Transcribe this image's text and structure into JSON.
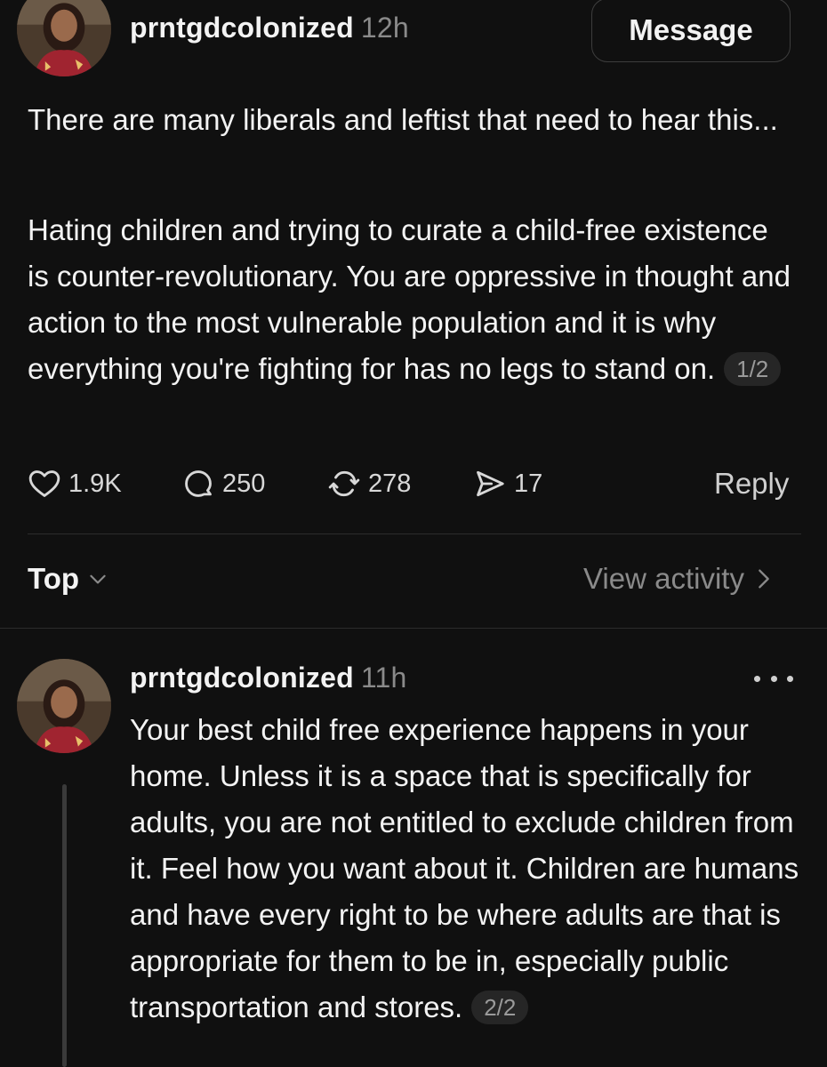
{
  "post": {
    "username": "prntgdcolonized",
    "time": "12h",
    "message_button": "Message",
    "paragraph1": "There are many liberals and leftist that need to hear this...",
    "paragraph2": "Hating children and trying to curate a child-free existence is counter-revolutionary. You are oppressive in thought and action to the most vulnerable population and it is why everything you're fighting for has no legs to stand on.",
    "page_indicator": "1/2",
    "actions": {
      "likes": "1.9K",
      "comments": "250",
      "reposts": "278",
      "shares": "17",
      "reply_label": "Reply"
    },
    "icons": [
      "heart-icon",
      "comment-icon",
      "repost-icon",
      "send-icon"
    ]
  },
  "sort": {
    "label": "Top",
    "view_activity": "View activity"
  },
  "reply": {
    "username": "prntgdcolonized",
    "time": "11h",
    "text": "Your best child free experience happens in your home. Unless it is a space that is specifically for adults, you are not entitled to exclude children from it. Feel how you want about it. Children are humans and have every right to be where adults are that is appropriate for them to be in, especially public transportation and stores.",
    "page_indicator": "2/2"
  },
  "colors": {
    "background": "#101010",
    "text": "#f3f3f3",
    "muted": "#8a8a8a",
    "divider": "#2c2c2c"
  }
}
